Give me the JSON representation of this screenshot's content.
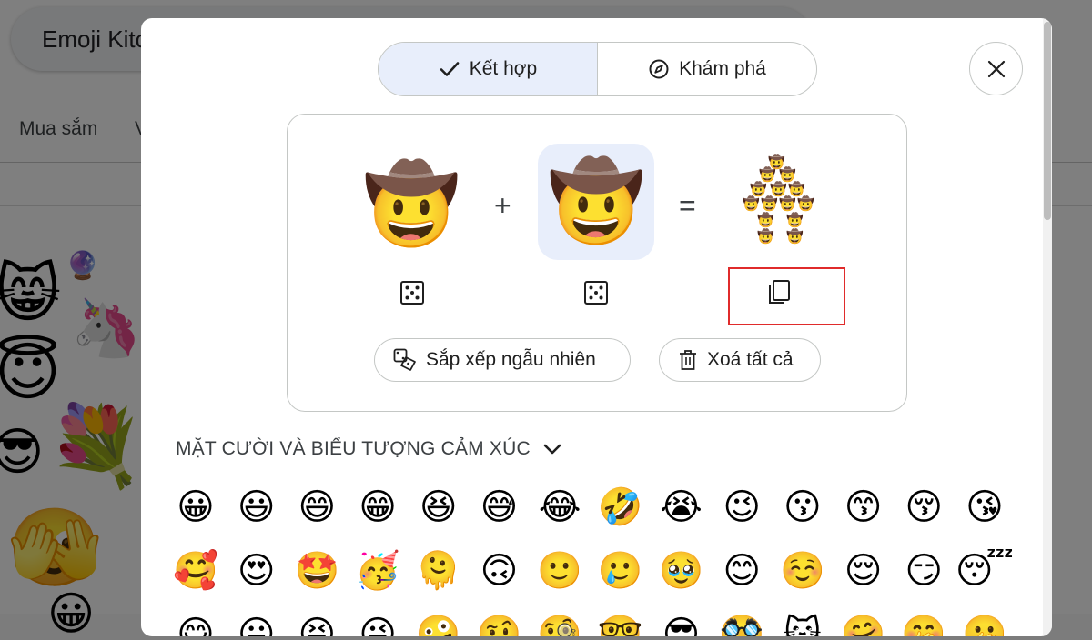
{
  "background": {
    "search_text": "Emoji Kitc",
    "nav": [
      "Mua sắm",
      "V"
    ],
    "emojis": [
      "😸",
      "🔮",
      "🦄",
      "😇",
      "💐",
      "🫣",
      "😎",
      "😀"
    ]
  },
  "dialog": {
    "tabs": [
      {
        "label": "Kết hợp",
        "icon": "check-icon",
        "active": true
      },
      {
        "label": "Khám phá",
        "icon": "compass-icon",
        "active": false
      }
    ],
    "close_icon": "close-icon",
    "mixer": {
      "left_emoji": "🤠",
      "right_emoji": "🤠",
      "plus": "+",
      "equals": "=",
      "result_emojis": [
        "🤠",
        "🤠",
        "🤠",
        "🤠",
        "🤠",
        "🤠",
        "🤠",
        "🤠",
        "🤠",
        "🤠",
        "🤠",
        "🤠",
        "🤠",
        "🤠"
      ]
    },
    "icons": {
      "left_dice": "dice-icon",
      "right_dice": "dice-icon",
      "copy": "copy-icon",
      "highlight_color": "#e02b2b",
      "accent_bg": "#e8eefb"
    },
    "buttons": {
      "shuffle": "Sắp xếp ngẫu nhiên",
      "clear": "Xoá tất cả"
    },
    "section": {
      "title": "MẶT CƯỜI VÀ BIỂU TƯỢNG CẢM XÚC"
    },
    "emoji_grid": [
      "😀",
      "😃",
      "😄",
      "😁",
      "😆",
      "😅",
      "😂",
      "🤣",
      "😭",
      "😉",
      "😗",
      "😙",
      "😚",
      "😘",
      "🥰",
      "😍",
      "🤩",
      "🥳",
      "🫠",
      "🙃",
      "🙂",
      "🥲",
      "🥹",
      "😊",
      "☺️",
      "😌",
      "😏",
      "😴",
      "😋",
      "😛",
      "😝",
      "😜",
      "🤪",
      "🤨",
      "🧐",
      "🤓",
      "😎",
      "🥸",
      "😺",
      "🤗",
      "🤭",
      "🫢"
    ]
  }
}
